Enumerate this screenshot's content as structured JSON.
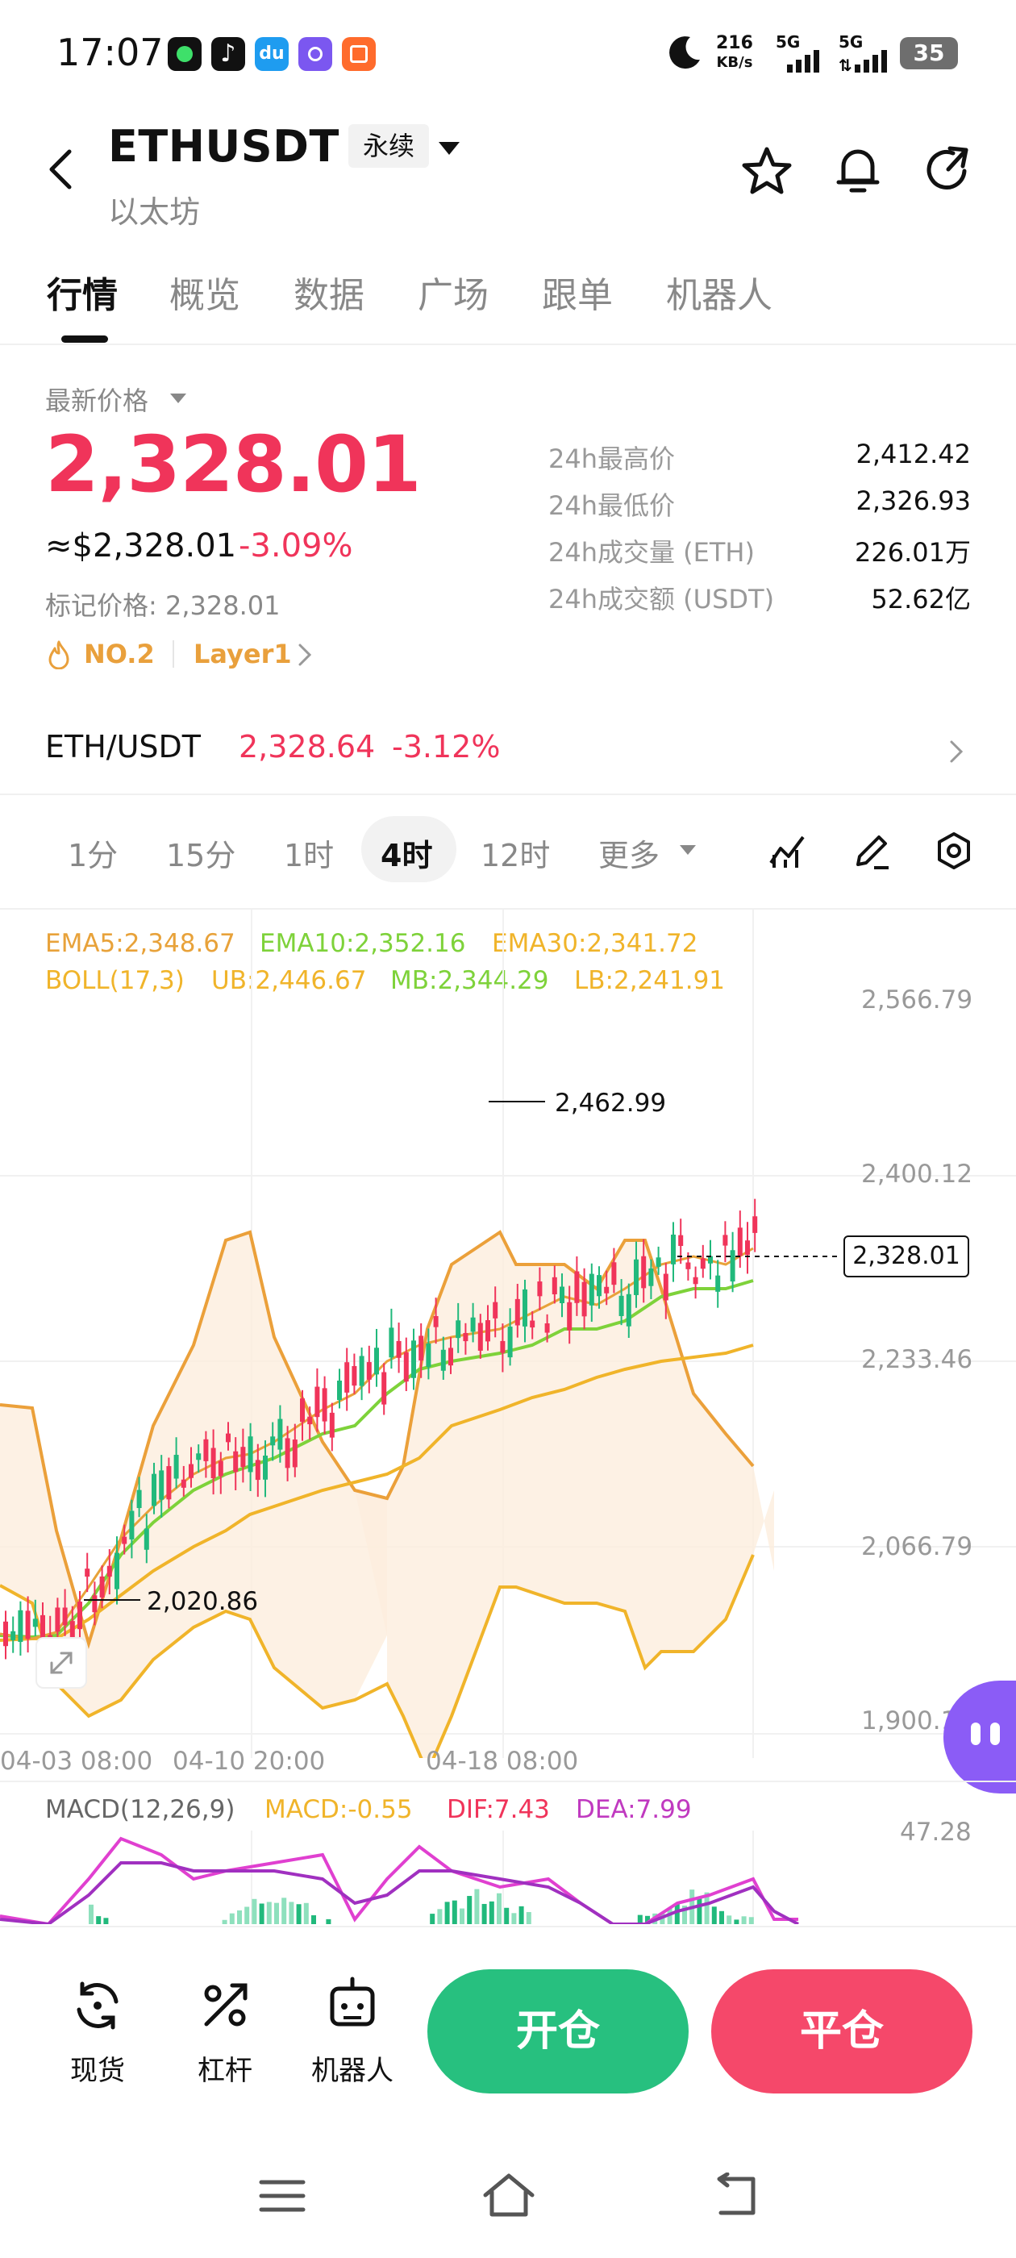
{
  "status": {
    "time": "17:07",
    "speed_value": "216",
    "speed_unit": "KB/s",
    "net1": "5G",
    "net2": "5G",
    "battery": "35"
  },
  "header": {
    "title": "ETHUSDT",
    "badge": "永续",
    "subtitle": "以太坊"
  },
  "tabs": [
    "行情",
    "概览",
    "数据",
    "广场",
    "跟单",
    "机器人"
  ],
  "price": {
    "label": "最新价格",
    "value": "2,328.01",
    "usd": "≈$2,328.01",
    "change": "-3.09%",
    "mark_label": "标记价格: 2,328.01",
    "rank": "NO.2",
    "tag": "Layer1"
  },
  "stats": [
    {
      "label": "24h最高价",
      "value": "2,412.42"
    },
    {
      "label": "24h最低价",
      "value": "2,326.93"
    },
    {
      "label": "24h成交量 (ETH)",
      "value": "226.01万"
    },
    {
      "label": "24h成交额 (USDT)",
      "value": "52.62亿"
    }
  ],
  "spot": {
    "pair": "ETH/USDT",
    "price": "2,328.64",
    "change": "-3.12%"
  },
  "timeframes": [
    "1分",
    "15分",
    "1时",
    "4时",
    "12时",
    "更多"
  ],
  "indicators": {
    "ema5": "EMA5:2,348.67",
    "ema10": "EMA10:2,352.16",
    "ema30": "EMA30:2,341.72",
    "boll": "BOLL(17,3)",
    "ub": "UB:2,446.67",
    "mb": "MB:2,344.29",
    "lb": "LB:2,241.91",
    "macd_title": "MACD(12,26,9)",
    "macd": "MACD:-0.55",
    "dif": "DIF:7.43",
    "dea": "DEA:7.99",
    "macd_axis": "47.28"
  },
  "chart_data": {
    "type": "candlestick",
    "y_ticks": [
      "2,566.79",
      "2,400.12",
      "2,233.46",
      "2,066.79",
      "1,900.1"
    ],
    "x_ticks": [
      "04-03 08:00",
      "04-10 20:00",
      "04-18 08:00"
    ],
    "ylim": [
      1900.1,
      2566.79
    ],
    "last_price": "2,328.01",
    "max_label": "2,462.99",
    "min_label": "2,020.86",
    "colors": {
      "up": "#21b97c",
      "down": "#f0345a",
      "ema5": "#e8a23a",
      "ema10": "#7ed23a",
      "ema30": "#f0b42a",
      "boll": "#f0a830"
    }
  },
  "bottom": {
    "spot_label": "现货",
    "leverage_label": "杠杆",
    "robot_label": "机器人",
    "open_label": "开仓",
    "close_label": "平仓",
    "open_color": "#27c07f",
    "close_color": "#f5486a"
  }
}
